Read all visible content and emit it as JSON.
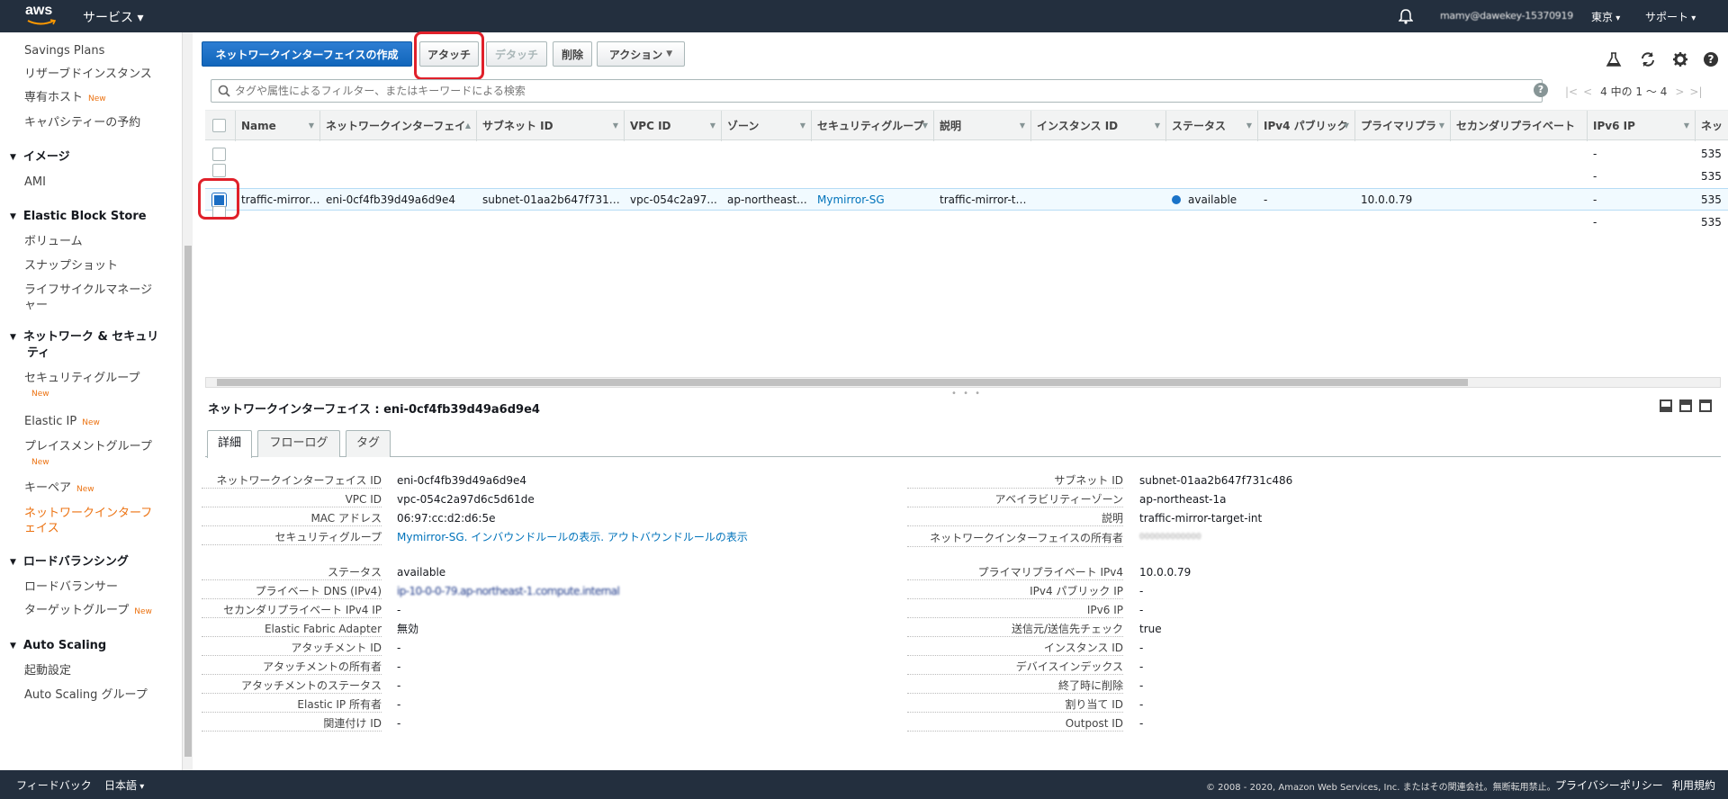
{
  "topbar": {
    "logo": "aws",
    "services": "サービス",
    "account": "mamy@dawekey-15370919",
    "region": "東京",
    "support": "サポート"
  },
  "sidebar": {
    "items": [
      {
        "label": "Savings Plans"
      },
      {
        "label": "リザーブドインスタンス"
      },
      {
        "label": "専有ホスト",
        "badge": "New"
      },
      {
        "label": "キャパシティーの予約"
      }
    ],
    "sections": [
      {
        "title": "イメージ",
        "items": [
          "AMI"
        ]
      },
      {
        "title": "Elastic Block Store",
        "items": [
          "ボリューム",
          "スナップショット",
          "ライフサイクルマネージャー"
        ]
      },
      {
        "title": "ネットワーク & セキュリティ",
        "items": [
          "セキュリティグループ",
          "Elastic IP",
          "プレイスメントグループ",
          "キーペア",
          "ネットワークインターフェイス"
        ]
      },
      {
        "title": "ロードバランシング",
        "items": [
          "ロードバランサー",
          "ターゲットグループ"
        ]
      },
      {
        "title": "Auto Scaling",
        "items": [
          "起動設定",
          "Auto Scaling グループ"
        ]
      }
    ],
    "new_badge": "New"
  },
  "toolbar": {
    "create": "ネットワークインターフェイスの作成",
    "attach": "アタッチ",
    "detach": "デタッチ",
    "delete": "削除",
    "actions": "アクション"
  },
  "filter": {
    "placeholder": "タグや属性によるフィルター、またはキーワードによる検索",
    "help": "?",
    "pager": "4 中の 1 ～ 4"
  },
  "table": {
    "columns": [
      "Name",
      "ネットワークインターフェイ",
      "サブネット ID",
      "VPC ID",
      "ゾーン",
      "セキュリティグループ",
      "説明",
      "インスタンス ID",
      "ステータス",
      "IPv4 パブリック",
      "プライマリプラ",
      "セカンダリプライベート",
      "IPv6 IP",
      "ネッ"
    ],
    "rows": [
      {
        "ipv6": "-",
        "extra": "535"
      },
      {
        "ipv6": "-",
        "extra": "535"
      },
      {
        "name": "traffic-mirror-int",
        "eni": "eni-0cf4fb39d49a6d9e4",
        "subnet": "subnet-01aa2b647f731c...",
        "vpc": "vpc-054c2a97...",
        "zone": "ap-northeast...",
        "sg": "Mymirror-SG",
        "desc": "traffic-mirror-ta...",
        "instance": "",
        "status": "available",
        "ipv4pub": "-",
        "primary": "10.0.0.79",
        "ipv6": "-",
        "extra": "535"
      },
      {
        "ipv6": "-",
        "extra": "535"
      }
    ]
  },
  "detail": {
    "title": "ネットワークインターフェイス : eni-0cf4fb39d49a6d9e4",
    "tabs": [
      "詳細",
      "フローログ",
      "タグ"
    ],
    "left": [
      {
        "k": "ネットワークインターフェイス ID",
        "v": "eni-0cf4fb39d49a6d9e4"
      },
      {
        "k": "VPC ID",
        "v": "vpc-054c2a97d6c5d61de"
      },
      {
        "k": "MAC アドレス",
        "v": "06:97:cc:d2:d6:5e"
      },
      {
        "k": "セキュリティグループ",
        "v": "Mymirror-SG. インバウンドルールの表示. アウトバウンドルールの表示"
      },
      {
        "k": "ステータス",
        "v": "available"
      },
      {
        "k": "プライベート DNS (IPv4)",
        "v": "ip-10-0-0-79.ap-northeast-1.compute.internal"
      },
      {
        "k": "セカンダリプライベート IPv4 IP",
        "v": "-"
      },
      {
        "k": "Elastic Fabric Adapter",
        "v": "無効"
      },
      {
        "k": "アタッチメント ID",
        "v": "-"
      },
      {
        "k": "アタッチメントの所有者",
        "v": "-"
      },
      {
        "k": "アタッチメントのステータス",
        "v": "-"
      },
      {
        "k": "Elastic IP 所有者",
        "v": "-"
      },
      {
        "k": "関連付け ID",
        "v": "-"
      }
    ],
    "right": [
      {
        "k": "サブネット ID",
        "v": "subnet-01aa2b647f731c486"
      },
      {
        "k": "アベイラビリティーゾーン",
        "v": "ap-northeast-1a"
      },
      {
        "k": "説明",
        "v": "traffic-mirror-target-int"
      },
      {
        "k": "ネットワークインターフェイスの所有者",
        "v": "000000000000"
      },
      {
        "k": "プライマリプライベート IPv4",
        "v": "10.0.0.79"
      },
      {
        "k": "IPv4 パブリック IP",
        "v": "-"
      },
      {
        "k": "IPv6 IP",
        "v": "-"
      },
      {
        "k": "送信元/送信先チェック",
        "v": "true"
      },
      {
        "k": "インスタンス ID",
        "v": "-"
      },
      {
        "k": "デバイスインデックス",
        "v": "-"
      },
      {
        "k": "終了時に削除",
        "v": "-"
      },
      {
        "k": "割り当て ID",
        "v": "-"
      },
      {
        "k": "Outpost ID",
        "v": "-"
      }
    ]
  },
  "footer": {
    "feedback": "フィードバック",
    "language": "日本語",
    "copyright": "© 2008 - 2020, Amazon Web Services, Inc. またはその関連会社。無断転用禁止。",
    "privacy": "プライバシーポリシー",
    "terms": "利用規約"
  },
  "colors": {
    "topbar": "#232f3e",
    "primary": "#1a6dc3",
    "active": "#ec7211",
    "highlight": "#e0202a"
  }
}
